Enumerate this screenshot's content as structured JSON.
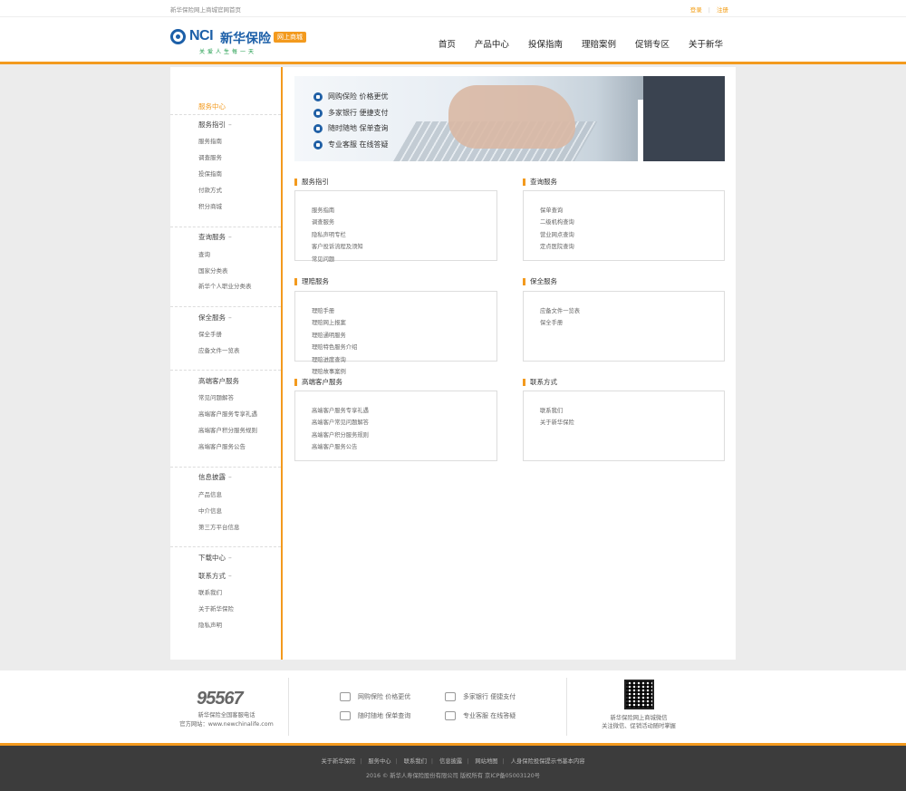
{
  "topbar": {
    "tagline": "新华保险网上商城官网首页",
    "login": "登录",
    "register": "注册"
  },
  "header": {
    "logo_latin": "NCI",
    "logo_cn": "新华保险",
    "logo_badge": "网上商城",
    "logo_slogan": "关爱人生每一天",
    "nav": [
      "首页",
      "产品中心",
      "投保指南",
      "理赔案例",
      "促销专区",
      "关于新华"
    ]
  },
  "sidebar": {
    "active_title": "服务中心",
    "groups": [
      {
        "title": "服务指引",
        "items": [
          "服务指南",
          "调查服务",
          "投保指南",
          "付款方式",
          "积分商城"
        ]
      },
      {
        "title": "查询服务",
        "items": [
          "查询",
          "国家分类表",
          "新华个人职业分类表"
        ]
      },
      {
        "title": "保全服务",
        "items": [
          "保全手册",
          "应备文件一览表"
        ]
      },
      {
        "title": "高端客户服务",
        "items": [
          "常见问题解答",
          "高端客户服务专享礼遇",
          "高端客户积分服务规则",
          "高端客户服务公告"
        ]
      },
      {
        "title": "信息披露",
        "items": [
          "产品信息",
          "中介信息",
          "第三方平台信息"
        ]
      },
      {
        "title": "下载中心",
        "items": []
      },
      {
        "title": "联系方式",
        "items": [
          "联系我们",
          "关于新华保险",
          "隐私声明"
        ]
      }
    ]
  },
  "banner": {
    "features": [
      "网购保险 价格更优",
      "多家银行 便捷支付",
      "随时随地 保单查询",
      "专业客服 在线答疑"
    ]
  },
  "sections": [
    {
      "title": "服务指引",
      "items": [
        "服务指南",
        "调查服务",
        "隐私声明专栏",
        "客户投诉流程及须知",
        "常见问题"
      ]
    },
    {
      "title": "查询服务",
      "items": [
        "保单查询",
        "二级机构查询",
        "营业网点查询",
        "定点医院查询"
      ]
    },
    {
      "title": "理赔服务",
      "items": [
        "理赔手册",
        "理赔网上报案",
        "理赔通明服务",
        "理赔特色服务介绍",
        "理赔进度查询",
        "理赔故事案例"
      ]
    },
    {
      "title": "保全服务",
      "items": [
        "应备文件一览表",
        "保全手册"
      ]
    },
    {
      "title": "高端客户服务",
      "items": [
        "高端客户服务专享礼遇",
        "高端客户常见问题解答",
        "高端客户积分服务规则",
        "高端客户服务公告"
      ]
    },
    {
      "title": "联系方式",
      "items": [
        "联系我们",
        "关于新华保险"
      ]
    }
  ],
  "footer": {
    "hotline": "95567",
    "hotline_desc": "新华保险全国客服电话",
    "website": "官方网站：www.newchinalife.com",
    "services": [
      "网购保险 价格更优",
      "多家银行 便捷支付",
      "随时随地 保单查询",
      "专业客服 在线答疑"
    ],
    "qr_line1": "新华保险网上商城微信",
    "qr_line2": "关注微信、促销活动随时掌握",
    "links": [
      "关于新华保险",
      "服务中心",
      "联系我们",
      "信息披露",
      "网站地图",
      "人身保险投保提示书基本内容"
    ],
    "copyright": "2016 © 新华人寿保险股份有限公司 版权所有 京ICP备05003120号"
  }
}
